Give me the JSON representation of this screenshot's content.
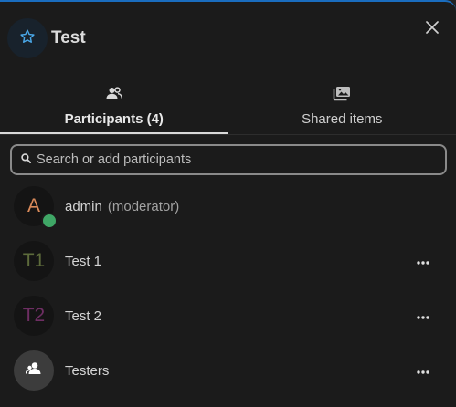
{
  "conversation": {
    "name": "Test"
  },
  "tabs": [
    {
      "label": "Participants (4)",
      "icon": "participants-icon",
      "active": true
    },
    {
      "label": "Shared items",
      "icon": "shared-items-icon",
      "active": false
    }
  ],
  "search": {
    "placeholder": "Search or add participants",
    "value": ""
  },
  "participants": [
    {
      "initials": "A",
      "name": "admin",
      "role": "(moderator)",
      "avatar_color": "#d98a5a",
      "online": true
    },
    {
      "initials": "T1",
      "name": "Test 1",
      "avatar_color": "#5d6b3b",
      "online": false
    },
    {
      "initials": "T2",
      "name": "Test 2",
      "avatar_color": "#6e2e63",
      "online": false
    },
    {
      "name": "Testers",
      "icon": "group-icon",
      "online": false
    }
  ],
  "colors": {
    "accent_top_border": "#1a6dbf",
    "online_status": "#3fa766",
    "favorite_star": "#4aa8e8"
  }
}
